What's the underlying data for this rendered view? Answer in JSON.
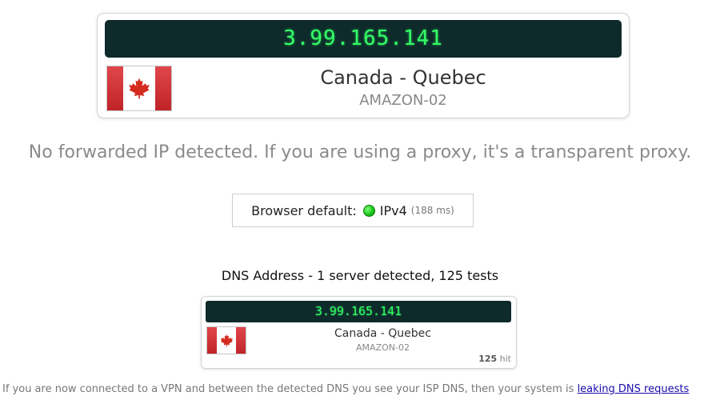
{
  "main_result": {
    "ip": "3.99.165.141",
    "location": "Canada - Quebec",
    "isp": "AMAZON-02",
    "flag_icon": "canada-flag-icon"
  },
  "forward_message": "No forwarded IP detected. If you are using a proxy, it's a transparent proxy.",
  "browser_default": {
    "label": "Browser default:",
    "status_icon": "green-dot-icon",
    "status_color": "#15c215",
    "protocol": "IPv4",
    "latency": "(188 ms)"
  },
  "dns": {
    "heading": "DNS Address - 1 server detected, 125 tests",
    "servers": [
      {
        "ip": "3.99.165.141",
        "location": "Canada - Quebec",
        "isp": "AMAZON-02",
        "flag_icon": "canada-flag-icon",
        "hit_count": "125",
        "hit_label": "hit"
      }
    ]
  },
  "footer": {
    "text": "If you are now connected to a VPN and between the detected DNS you see your ISP DNS, then your system is ",
    "link": "leaking DNS requests"
  },
  "colors": {
    "banner_bg": "#0e2a2b",
    "banner_text": "#33ff66",
    "flag_red": "#d52b1e"
  }
}
